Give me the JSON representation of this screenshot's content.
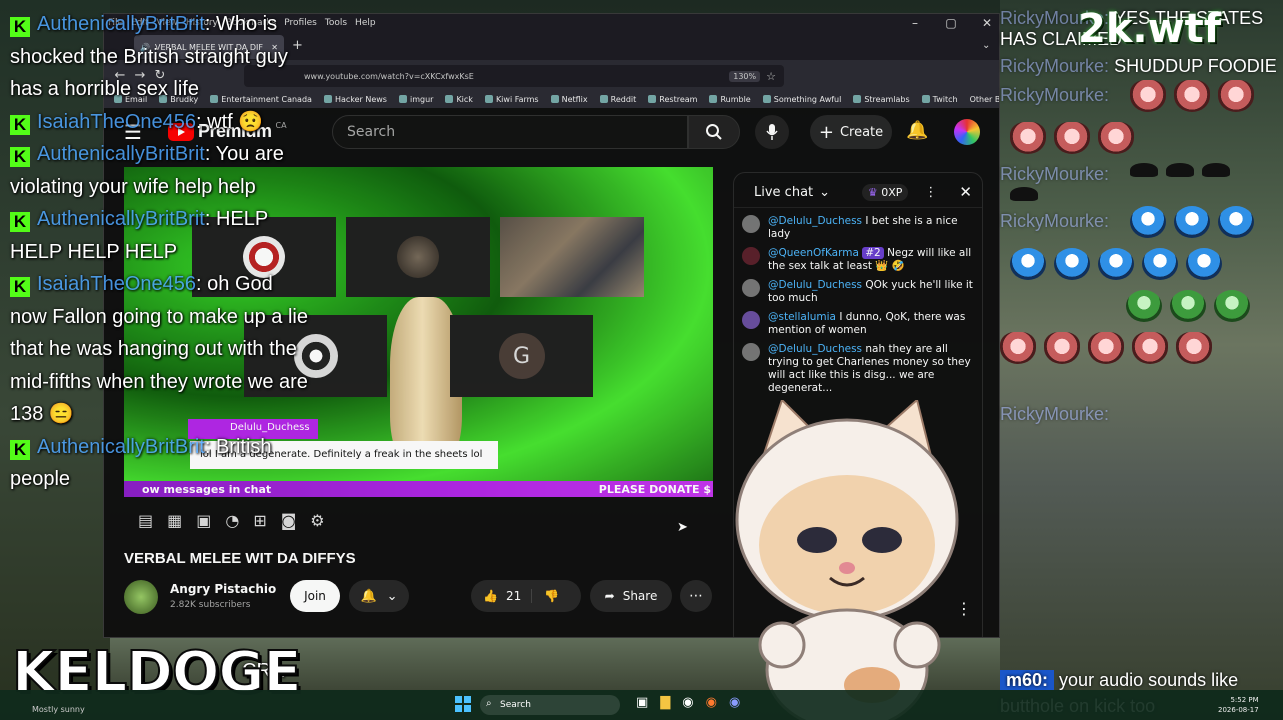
{
  "left_chat": {
    "messages": [
      {
        "user": "AuthenicallyBritBrit",
        "text": "Who is shocked the British straight guy has a horrible sex life"
      },
      {
        "user": "IsaiahTheOne456",
        "text": "wtf 😟"
      },
      {
        "user": "AuthenicallyBritBrit",
        "text": "You are violating your wife help help"
      },
      {
        "user": "AuthenicallyBritBrit",
        "text": "HELP HELP HELP HELP"
      },
      {
        "user": "IsaiahTheOne456",
        "text": "oh God now Fallon going to make up a lie that he was hanging out with the mid-fifths when they wrote we are 138 😑"
      },
      {
        "user": "AuthenicallyBritBrit",
        "text": "British people"
      }
    ],
    "trailing_text": "CRA"
  },
  "overlay": {
    "brand_top": "2k.wtf",
    "brand_bottom": "KELDOGE",
    "bottom_left_tag": "Mostly sunny"
  },
  "right_chat": {
    "lines": [
      {
        "user": "RickyMourke:",
        "text": "YES THE STATES HAS CLAIMED"
      },
      {
        "user": "RickyMourke:",
        "text": "SHUDDUP FOODIE"
      },
      {
        "user": "RickyMourke:",
        "text": ""
      },
      {
        "user": "RickyMourke:",
        "text": ""
      },
      {
        "user": "RickyMourke:",
        "text": ""
      },
      {
        "user": "RickyMourke:",
        "text": ""
      }
    ],
    "m60_user": "m60:",
    "m60_text": "your audio sounds like butthole on kick too"
  },
  "browser": {
    "menu": [
      "File",
      "Edit",
      "View",
      "History",
      "Bookmarks",
      "Profiles",
      "Tools",
      "Help"
    ],
    "tab_title": "VERBAL MELEE WIT DA DIF",
    "url": "www.youtube.com/watch?v=cXKCxfwxKsE",
    "zoom": "130%",
    "bookmarks": [
      "Email",
      "Brudky",
      "Entertainment Canada",
      "Hacker News",
      "imgur",
      "Kick",
      "Kiwi Farms",
      "Netflix",
      "Reddit",
      "Restream",
      "Rumble",
      "Something Awful",
      "Streamlabs",
      "Twitch"
    ],
    "other_bookmarks": "Other Bookmarks"
  },
  "youtube": {
    "logo_text": "Premium",
    "region": "CA",
    "search_placeholder": "Search",
    "create_label": "Create",
    "video_title": "VERBAL MELEE WIT DA DIFFYS",
    "channel_name": "Angry Pistachio",
    "subscribers": "2.82K subscribers",
    "join_label": "Join",
    "like_count": "21",
    "share_label": "Share",
    "caption_user": "Delulu_Duchess",
    "caption_text": "lol I am a degenerate. Definitely a freak in the sheets lol",
    "banner_left": "ow messages in chat",
    "banner_right": "PLEASE DONATE $",
    "tile_g": "G"
  },
  "live_chat": {
    "title": "Live chat",
    "xp": "0XP",
    "messages": [
      {
        "user": "@Delulu_Duchess",
        "text": "I bet she is a nice lady",
        "avatar": "#777777"
      },
      {
        "user": "@QueenOfKarma",
        "badge": "#2",
        "text": "Negz will like all the sex talk at least 👑 🤣",
        "avatar": "#5a1f2a"
      },
      {
        "user": "@Delulu_Duchess",
        "text": "QOk yuck he'll like it too much",
        "avatar": "#777777"
      },
      {
        "user": "@stellalumia",
        "text": "I dunno, QoK, there was mention of women",
        "avatar": "#6a4ea0"
      },
      {
        "user": "@Delulu_Duchess",
        "text": "nah they are all trying to get Charlenes money so they will act like this is disg... we are degenerat...",
        "avatar": "#777777"
      }
    ]
  },
  "taskbar": {
    "search_label": "Search",
    "time": "5:52 PM",
    "date": "2026-08-17"
  }
}
